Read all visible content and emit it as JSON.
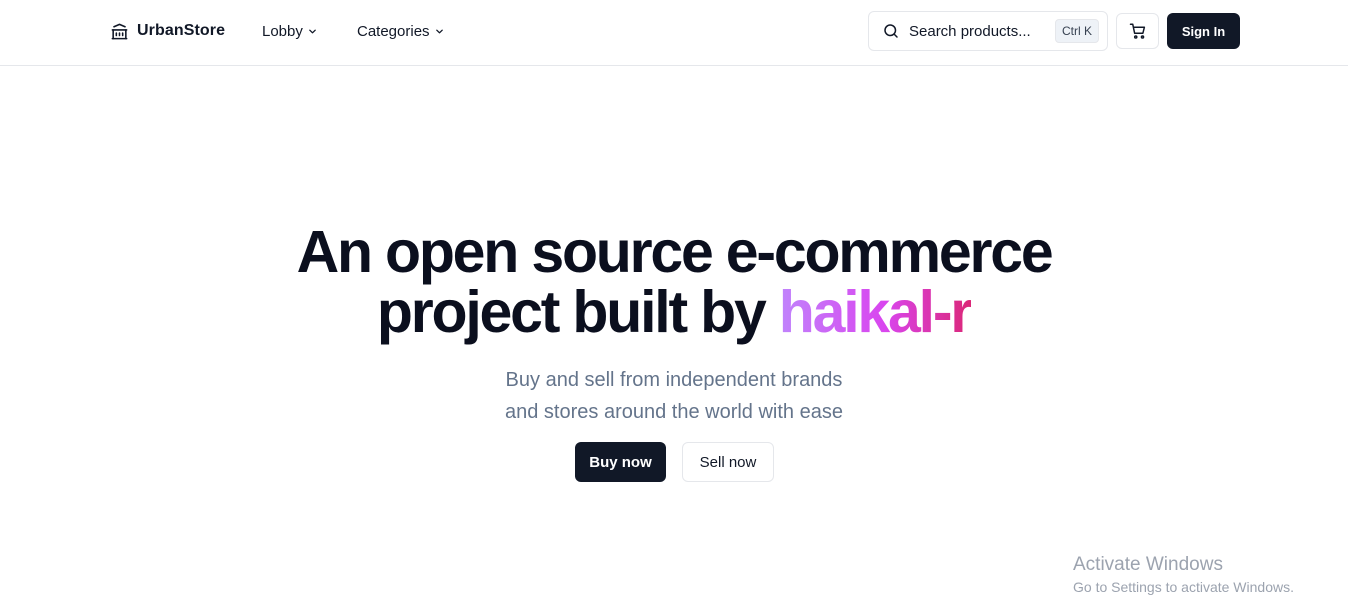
{
  "header": {
    "brand_name": "UrbanStore",
    "brand_icon": "bank-icon",
    "nav": [
      {
        "label": "Lobby",
        "icon": "chevron-down-icon"
      },
      {
        "label": "Categories",
        "icon": "chevron-down-icon"
      }
    ],
    "search": {
      "placeholder": "Search products...",
      "shortcut": "Ctrl K",
      "icon": "search-icon"
    },
    "cart_icon": "cart-icon",
    "signin_label": "Sign In"
  },
  "hero": {
    "title_line1": "An open source e-commerce",
    "title_line2_prefix": "project built by ",
    "title_highlight": "haikal-r",
    "subtitle_line1": "Buy and sell from independent brands",
    "subtitle_line2": "and stores around the world with ease",
    "buy_label": "Buy now",
    "sell_label": "Sell now"
  },
  "watermark": {
    "title": "Activate Windows",
    "subtitle": "Go to Settings to activate Windows."
  },
  "colors": {
    "primary": "#111827",
    "muted_text": "#64748b",
    "border": "#e5e7eb",
    "gradient": [
      "#c084fc",
      "#d946ef",
      "#db2777"
    ]
  }
}
